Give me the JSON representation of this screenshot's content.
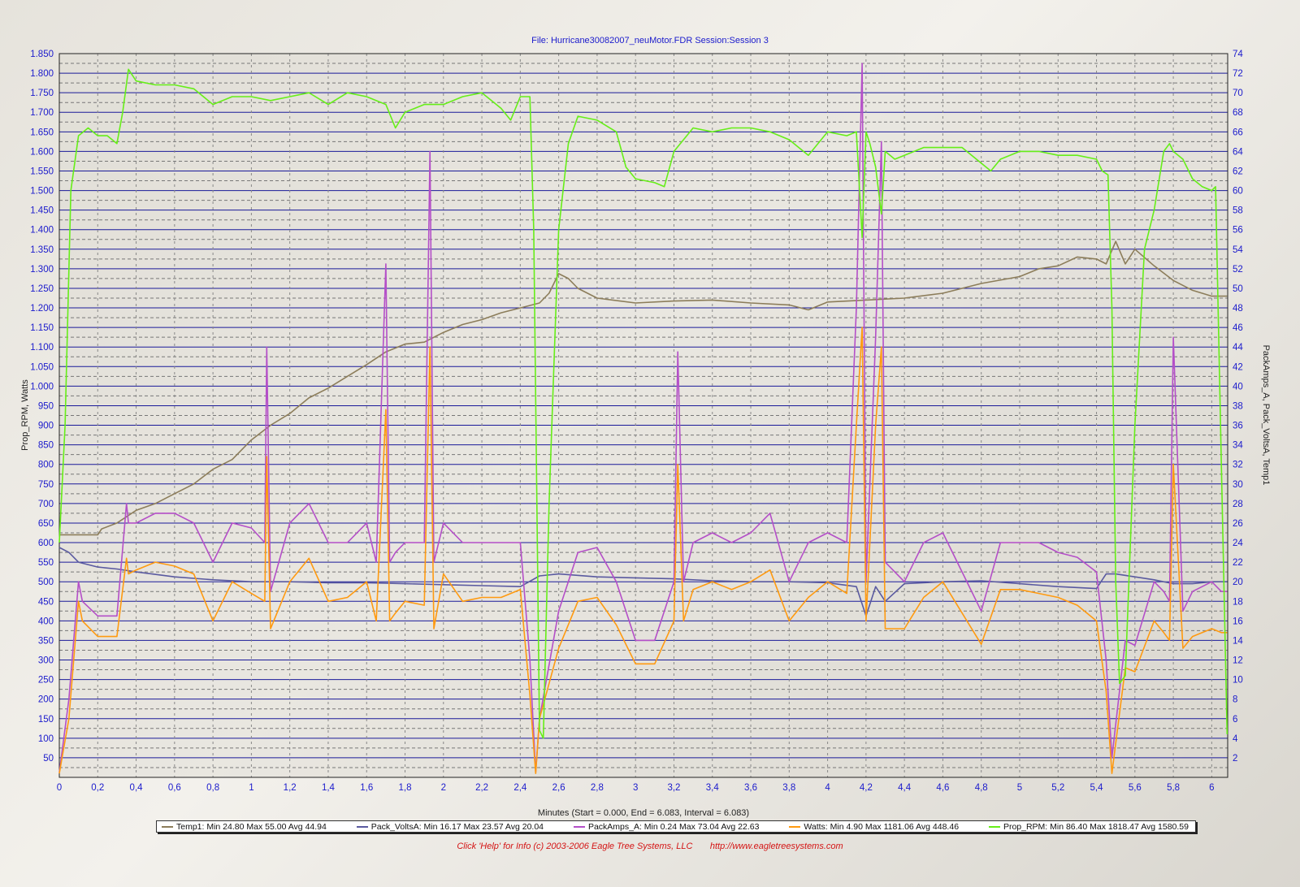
{
  "title": "File: Hurricane30082007_neuMotor.FDR   Session:Session 3",
  "footer": {
    "help_text": "Click 'Help' for Info  (c) 2003-2006 Eagle Tree Systems, LLC",
    "url_text": "http://www.eagletreesystems.com"
  },
  "chart_data": {
    "type": "line",
    "xlabel": "Minutes (Start = 0.000,  End = 6.083,  Interval =  6.083)",
    "ylabel_left": "Prop_RPM, Watts",
    "ylabel_right": "PackAmps_A, Pack_VoltsA, Temp1",
    "xlim": [
      0,
      6.083
    ],
    "ylim_left": [
      0,
      1850
    ],
    "ylim_right": [
      0,
      74
    ],
    "x_ticks": [
      "0",
      "0,2",
      "0,4",
      "0,6",
      "0,8",
      "1",
      "1,2",
      "1,4",
      "1,6",
      "1,8",
      "2",
      "2,2",
      "2,4",
      "2,6",
      "2,8",
      "3",
      "3,2",
      "3,4",
      "3,6",
      "3,8",
      "4",
      "4,2",
      "4,4",
      "4,6",
      "4,8",
      "5",
      "5,2",
      "5,4",
      "5,6",
      "5,8",
      "6"
    ],
    "y_left_ticks": [
      "1.850",
      "1.800",
      "1.750",
      "1.700",
      "1.650",
      "1.600",
      "1.550",
      "1.500",
      "1.450",
      "1.400",
      "1.350",
      "1.300",
      "1.250",
      "1.200",
      "1.150",
      "1.100",
      "1.050",
      "1.000",
      "950",
      "900",
      "850",
      "800",
      "750",
      "700",
      "650",
      "600",
      "550",
      "500",
      "450",
      "400",
      "350",
      "300",
      "250",
      "200",
      "150",
      "100",
      "50"
    ],
    "y_right_ticks": [
      "74",
      "72",
      "70",
      "68",
      "66",
      "64",
      "62",
      "60",
      "58",
      "56",
      "54",
      "52",
      "50",
      "48",
      "46",
      "44",
      "42",
      "40",
      "38",
      "36",
      "34",
      "32",
      "30",
      "28",
      "26",
      "24",
      "22",
      "20",
      "18",
      "16",
      "14",
      "12",
      "10",
      "8",
      "6",
      "4",
      "2"
    ],
    "grid": true,
    "legend_position": "bottom",
    "series": [
      {
        "name": "Temp1",
        "legend_text": "Temp1:  Min 24.80 Max 55.00 Avg 44.94",
        "color": "#8c7d5a",
        "axis": "right",
        "x": [
          0,
          0.2,
          0.22,
          0.3,
          0.4,
          0.5,
          0.6,
          0.7,
          0.8,
          0.9,
          1.0,
          1.1,
          1.2,
          1.3,
          1.4,
          1.5,
          1.6,
          1.7,
          1.8,
          1.9,
          2.0,
          2.1,
          2.2,
          2.3,
          2.4,
          2.5,
          2.55,
          2.6,
          2.65,
          2.7,
          2.8,
          3.0,
          3.2,
          3.4,
          3.6,
          3.8,
          3.9,
          4.0,
          4.2,
          4.4,
          4.6,
          4.8,
          5.0,
          5.1,
          5.2,
          5.3,
          5.4,
          5.45,
          5.5,
          5.55,
          5.6,
          5.7,
          5.8,
          5.9,
          6.0,
          6.08
        ],
        "y": [
          24.8,
          24.8,
          25.4,
          26.0,
          27.3,
          28.0,
          29.0,
          30.0,
          31.5,
          32.5,
          34.5,
          36.0,
          37.2,
          38.8,
          39.8,
          41.0,
          42.2,
          43.5,
          44.3,
          44.5,
          45.5,
          46.3,
          46.8,
          47.5,
          48.0,
          48.5,
          49.5,
          51.5,
          51.0,
          50.0,
          49.0,
          48.5,
          48.7,
          48.8,
          48.5,
          48.3,
          47.8,
          48.6,
          48.8,
          49.0,
          49.5,
          50.5,
          51.2,
          52.0,
          52.3,
          53.2,
          53.0,
          52.5,
          54.8,
          52.5,
          54.0,
          52.3,
          50.8,
          49.8,
          49.2,
          49.2
        ]
      },
      {
        "name": "Pack_VoltsA",
        "legend_text": "Pack_VoltsA:  Min 16.17 Max 23.57 Avg 20.04",
        "color": "#5a5aa0",
        "axis": "right",
        "x": [
          0,
          0.05,
          0.1,
          0.2,
          0.3,
          0.4,
          0.6,
          0.8,
          1.0,
          1.2,
          1.4,
          1.6,
          1.8,
          2.0,
          2.2,
          2.4,
          2.5,
          2.6,
          2.8,
          3.0,
          3.2,
          3.4,
          3.6,
          3.8,
          4.0,
          4.15,
          4.2,
          4.25,
          4.3,
          4.4,
          4.6,
          4.8,
          5.0,
          5.2,
          5.4,
          5.45,
          5.5,
          5.6,
          5.7,
          5.8,
          5.9,
          6.0,
          6.08
        ],
        "y": [
          23.5,
          23.0,
          22.0,
          21.5,
          21.3,
          21.0,
          20.5,
          20.2,
          20.0,
          20.0,
          19.9,
          19.9,
          19.8,
          19.7,
          19.6,
          19.5,
          20.6,
          20.8,
          20.5,
          20.4,
          20.3,
          20.1,
          20.0,
          20.0,
          19.9,
          19.5,
          16.5,
          19.5,
          18.0,
          19.8,
          20.0,
          20.1,
          19.8,
          19.5,
          19.3,
          20.8,
          20.8,
          20.5,
          20.2,
          19.8,
          19.8,
          20.0,
          20.0
        ]
      },
      {
        "name": "PackAmps_A",
        "legend_text": "PackAmps_A:  Min 0.24 Max 73.04 Avg 22.63",
        "color": "#b44fc8",
        "axis": "right",
        "x": [
          0,
          0.05,
          0.1,
          0.12,
          0.2,
          0.3,
          0.35,
          0.36,
          0.4,
          0.5,
          0.6,
          0.7,
          0.8,
          0.9,
          1.0,
          1.07,
          1.08,
          1.1,
          1.2,
          1.3,
          1.4,
          1.5,
          1.6,
          1.65,
          1.7,
          1.72,
          1.75,
          1.8,
          1.9,
          1.93,
          1.95,
          2.0,
          2.1,
          2.2,
          2.3,
          2.4,
          2.45,
          2.48,
          2.5,
          2.6,
          2.7,
          2.8,
          2.9,
          3.0,
          3.1,
          3.2,
          3.22,
          3.25,
          3.3,
          3.4,
          3.5,
          3.6,
          3.7,
          3.8,
          3.9,
          4.0,
          4.1,
          4.15,
          4.18,
          4.2,
          4.22,
          4.25,
          4.28,
          4.3,
          4.4,
          4.5,
          4.6,
          4.7,
          4.8,
          4.9,
          5.0,
          5.1,
          5.2,
          5.3,
          5.4,
          5.45,
          5.48,
          5.55,
          5.6,
          5.7,
          5.75,
          5.78,
          5.8,
          5.85,
          5.9,
          6.0,
          6.05,
          6.08
        ],
        "y": [
          0.5,
          8.0,
          20.0,
          18.0,
          16.5,
          16.5,
          28.0,
          26.0,
          26.0,
          27.0,
          27.0,
          26.0,
          22.0,
          26.0,
          25.5,
          24.0,
          44.0,
          19.0,
          26.0,
          28.0,
          24.0,
          24.0,
          26.0,
          22.0,
          52.5,
          22.0,
          23.0,
          24.0,
          24.0,
          64.0,
          22.0,
          26.0,
          24.0,
          24.0,
          24.0,
          24.0,
          12.0,
          0.5,
          6.0,
          17.0,
          23.0,
          23.5,
          20.0,
          14.0,
          14.0,
          20.0,
          43.5,
          20.0,
          24.0,
          25.0,
          24.0,
          25.0,
          27.0,
          20.0,
          24.0,
          25.0,
          24.0,
          48.0,
          73.0,
          20.0,
          30.0,
          45.0,
          65.0,
          22.0,
          20.0,
          24.0,
          25.0,
          21.0,
          17.0,
          24.0,
          24.0,
          24.0,
          23.0,
          22.5,
          21.0,
          12.0,
          2.0,
          14.0,
          13.5,
          20.0,
          19.0,
          18.0,
          45.0,
          17.0,
          19.0,
          20.0,
          19.0,
          19.0
        ]
      },
      {
        "name": "Watts",
        "legend_text": "Watts:  Min 4.90 Max 1181.06 Avg 448.46",
        "color": "#ff9a10",
        "axis": "left",
        "x": [
          0,
          0.05,
          0.1,
          0.12,
          0.2,
          0.3,
          0.35,
          0.36,
          0.4,
          0.5,
          0.6,
          0.7,
          0.8,
          0.9,
          1.0,
          1.07,
          1.08,
          1.1,
          1.2,
          1.3,
          1.4,
          1.5,
          1.6,
          1.65,
          1.7,
          1.72,
          1.75,
          1.8,
          1.9,
          1.93,
          1.95,
          2.0,
          2.1,
          2.2,
          2.3,
          2.4,
          2.45,
          2.48,
          2.5,
          2.6,
          2.7,
          2.8,
          2.9,
          3.0,
          3.1,
          3.2,
          3.22,
          3.25,
          3.3,
          3.4,
          3.5,
          3.6,
          3.7,
          3.8,
          3.9,
          4.0,
          4.1,
          4.15,
          4.18,
          4.2,
          4.22,
          4.25,
          4.28,
          4.3,
          4.4,
          4.5,
          4.6,
          4.7,
          4.8,
          4.9,
          5.0,
          5.1,
          5.2,
          5.3,
          5.4,
          5.45,
          5.48,
          5.55,
          5.6,
          5.7,
          5.75,
          5.78,
          5.8,
          5.85,
          5.9,
          6.0,
          6.05,
          6.08
        ],
        "y": [
          10,
          150,
          450,
          400,
          360,
          360,
          560,
          520,
          530,
          550,
          540,
          520,
          400,
          500,
          470,
          450,
          820,
          380,
          500,
          560,
          450,
          460,
          500,
          400,
          940,
          400,
          420,
          450,
          440,
          1100,
          380,
          520,
          450,
          460,
          460,
          480,
          210,
          10,
          150,
          330,
          450,
          460,
          390,
          290,
          290,
          400,
          800,
          400,
          480,
          500,
          480,
          500,
          530,
          400,
          460,
          500,
          470,
          900,
          1150,
          400,
          600,
          900,
          1100,
          380,
          380,
          460,
          500,
          420,
          340,
          480,
          480,
          470,
          460,
          440,
          400,
          220,
          10,
          280,
          270,
          400,
          370,
          350,
          800,
          330,
          360,
          380,
          370,
          370
        ]
      },
      {
        "name": "Prop_RPM",
        "legend_text": "Prop_RPM:  Min 86.40 Max 1818.47 Avg 1580.59",
        "color": "#66ee18",
        "axis": "left",
        "x": [
          0,
          0.03,
          0.06,
          0.1,
          0.15,
          0.2,
          0.25,
          0.3,
          0.33,
          0.36,
          0.4,
          0.5,
          0.6,
          0.7,
          0.8,
          0.9,
          1.0,
          1.1,
          1.2,
          1.3,
          1.4,
          1.5,
          1.6,
          1.7,
          1.75,
          1.8,
          1.9,
          2.0,
          2.1,
          2.2,
          2.3,
          2.35,
          2.4,
          2.45,
          2.47,
          2.5,
          2.52,
          2.55,
          2.6,
          2.65,
          2.7,
          2.8,
          2.9,
          2.95,
          3.0,
          3.1,
          3.15,
          3.2,
          3.3,
          3.4,
          3.5,
          3.6,
          3.7,
          3.8,
          3.9,
          4.0,
          4.1,
          4.15,
          4.18,
          4.2,
          4.22,
          4.25,
          4.28,
          4.3,
          4.35,
          4.4,
          4.5,
          4.6,
          4.7,
          4.8,
          4.85,
          4.9,
          5.0,
          5.1,
          5.2,
          5.3,
          5.4,
          5.43,
          5.46,
          5.48,
          5.5,
          5.52,
          5.55,
          5.6,
          5.65,
          5.7,
          5.75,
          5.78,
          5.8,
          5.85,
          5.9,
          5.95,
          6.0,
          6.02,
          6.05,
          6.08
        ],
        "y": [
          600,
          900,
          1500,
          1640,
          1660,
          1640,
          1640,
          1620,
          1700,
          1810,
          1780,
          1770,
          1770,
          1760,
          1720,
          1740,
          1740,
          1730,
          1740,
          1750,
          1720,
          1750,
          1740,
          1720,
          1660,
          1700,
          1720,
          1720,
          1740,
          1750,
          1710,
          1680,
          1740,
          1740,
          1400,
          120,
          100,
          700,
          1400,
          1620,
          1690,
          1680,
          1650,
          1560,
          1530,
          1520,
          1510,
          1600,
          1660,
          1650,
          1660,
          1660,
          1650,
          1630,
          1590,
          1650,
          1640,
          1650,
          1380,
          1650,
          1620,
          1560,
          1440,
          1600,
          1580,
          1590,
          1610,
          1610,
          1610,
          1570,
          1550,
          1580,
          1600,
          1600,
          1590,
          1590,
          1580,
          1550,
          1540,
          1200,
          500,
          240,
          260,
          900,
          1350,
          1450,
          1600,
          1620,
          1600,
          1580,
          1530,
          1510,
          1500,
          1510,
          800,
          110
        ]
      }
    ]
  }
}
